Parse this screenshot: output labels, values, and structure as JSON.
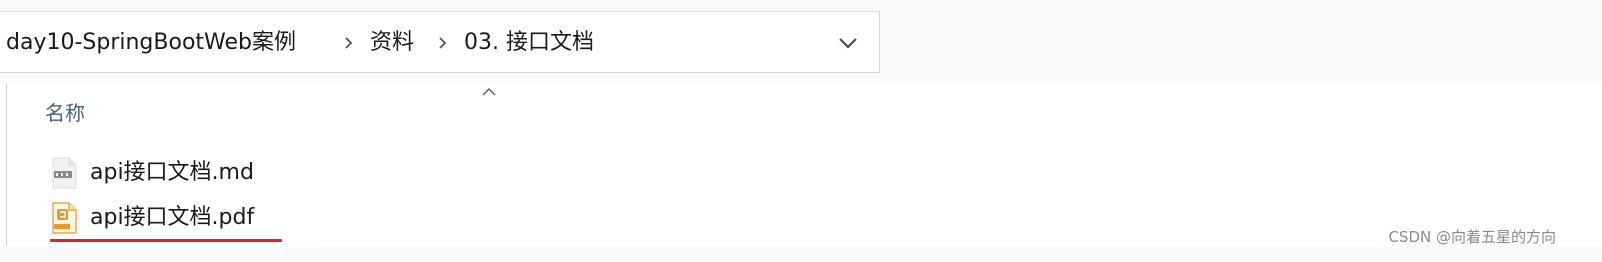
{
  "breadcrumb": {
    "items": [
      "day10-SpringBootWeb案例",
      "资料",
      "03. 接口文档"
    ],
    "separator_icon": "chevron-right-icon",
    "dropdown_icon": "chevron-down-icon"
  },
  "file_list": {
    "column_header": "名称",
    "sort_icon": "chevron-up-icon",
    "files": [
      {
        "name": "api接口文档.md",
        "icon": "markdown-file-icon"
      },
      {
        "name": "api接口文档.pdf",
        "icon": "pdf-file-icon"
      }
    ],
    "highlight_color": "#e0202d"
  },
  "watermark": "CSDN @向着五星的方向"
}
